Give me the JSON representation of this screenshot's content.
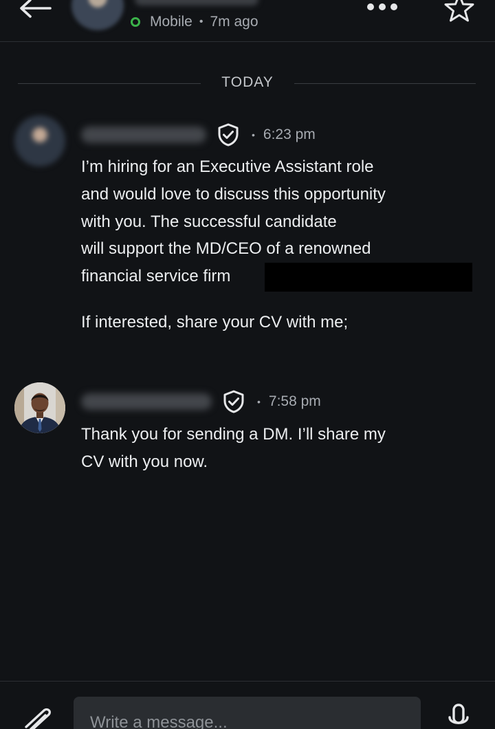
{
  "header": {
    "status_text": "Mobile",
    "last_seen": "7m ago",
    "status_color": "#3bb34a",
    "icons": [
      "arrow-left-icon",
      "more-horizontal-icon",
      "star-icon"
    ]
  },
  "thread": {
    "day_label": "TODAY",
    "messages": [
      {
        "time": "6:23 pm",
        "lines": [
          "I’m hiring for an Executive Assistant role",
          "and would love to discuss this opportunity",
          "with you. The successful candidate",
          "will support the MD/CEO of a renowned",
          "financial service firm"
        ],
        "follow_up": "If interested, share your CV with me;"
      },
      {
        "time": "7:58 pm",
        "lines": [
          "Thank you for sending a DM. I’ll share my",
          "CV with you now."
        ]
      }
    ]
  },
  "composer": {
    "placeholder": "Write a message...",
    "icons": [
      "paperclip-icon",
      "microphone-icon"
    ]
  },
  "colors": {
    "background": "#111316",
    "text": "#eceef0",
    "muted": "#a7abb1",
    "input_bg": "#2a2d31"
  }
}
